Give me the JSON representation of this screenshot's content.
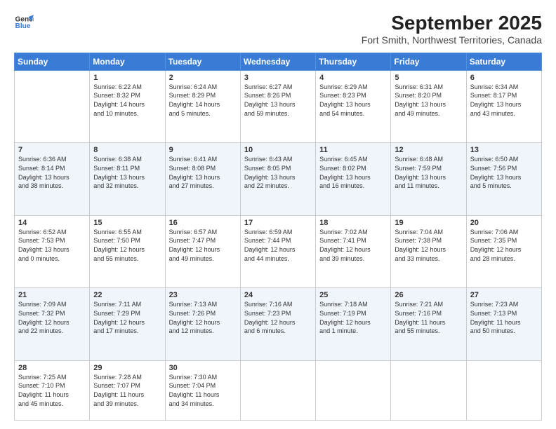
{
  "header": {
    "logo_line1": "General",
    "logo_line2": "Blue",
    "title": "September 2025",
    "subtitle": "Fort Smith, Northwest Territories, Canada"
  },
  "weekdays": [
    "Sunday",
    "Monday",
    "Tuesday",
    "Wednesday",
    "Thursday",
    "Friday",
    "Saturday"
  ],
  "weeks": [
    [
      {
        "num": "",
        "info": ""
      },
      {
        "num": "1",
        "info": "Sunrise: 6:22 AM\nSunset: 8:32 PM\nDaylight: 14 hours\nand 10 minutes."
      },
      {
        "num": "2",
        "info": "Sunrise: 6:24 AM\nSunset: 8:29 PM\nDaylight: 14 hours\nand 5 minutes."
      },
      {
        "num": "3",
        "info": "Sunrise: 6:27 AM\nSunset: 8:26 PM\nDaylight: 13 hours\nand 59 minutes."
      },
      {
        "num": "4",
        "info": "Sunrise: 6:29 AM\nSunset: 8:23 PM\nDaylight: 13 hours\nand 54 minutes."
      },
      {
        "num": "5",
        "info": "Sunrise: 6:31 AM\nSunset: 8:20 PM\nDaylight: 13 hours\nand 49 minutes."
      },
      {
        "num": "6",
        "info": "Sunrise: 6:34 AM\nSunset: 8:17 PM\nDaylight: 13 hours\nand 43 minutes."
      }
    ],
    [
      {
        "num": "7",
        "info": "Sunrise: 6:36 AM\nSunset: 8:14 PM\nDaylight: 13 hours\nand 38 minutes."
      },
      {
        "num": "8",
        "info": "Sunrise: 6:38 AM\nSunset: 8:11 PM\nDaylight: 13 hours\nand 32 minutes."
      },
      {
        "num": "9",
        "info": "Sunrise: 6:41 AM\nSunset: 8:08 PM\nDaylight: 13 hours\nand 27 minutes."
      },
      {
        "num": "10",
        "info": "Sunrise: 6:43 AM\nSunset: 8:05 PM\nDaylight: 13 hours\nand 22 minutes."
      },
      {
        "num": "11",
        "info": "Sunrise: 6:45 AM\nSunset: 8:02 PM\nDaylight: 13 hours\nand 16 minutes."
      },
      {
        "num": "12",
        "info": "Sunrise: 6:48 AM\nSunset: 7:59 PM\nDaylight: 13 hours\nand 11 minutes."
      },
      {
        "num": "13",
        "info": "Sunrise: 6:50 AM\nSunset: 7:56 PM\nDaylight: 13 hours\nand 5 minutes."
      }
    ],
    [
      {
        "num": "14",
        "info": "Sunrise: 6:52 AM\nSunset: 7:53 PM\nDaylight: 13 hours\nand 0 minutes."
      },
      {
        "num": "15",
        "info": "Sunrise: 6:55 AM\nSunset: 7:50 PM\nDaylight: 12 hours\nand 55 minutes."
      },
      {
        "num": "16",
        "info": "Sunrise: 6:57 AM\nSunset: 7:47 PM\nDaylight: 12 hours\nand 49 minutes."
      },
      {
        "num": "17",
        "info": "Sunrise: 6:59 AM\nSunset: 7:44 PM\nDaylight: 12 hours\nand 44 minutes."
      },
      {
        "num": "18",
        "info": "Sunrise: 7:02 AM\nSunset: 7:41 PM\nDaylight: 12 hours\nand 39 minutes."
      },
      {
        "num": "19",
        "info": "Sunrise: 7:04 AM\nSunset: 7:38 PM\nDaylight: 12 hours\nand 33 minutes."
      },
      {
        "num": "20",
        "info": "Sunrise: 7:06 AM\nSunset: 7:35 PM\nDaylight: 12 hours\nand 28 minutes."
      }
    ],
    [
      {
        "num": "21",
        "info": "Sunrise: 7:09 AM\nSunset: 7:32 PM\nDaylight: 12 hours\nand 22 minutes."
      },
      {
        "num": "22",
        "info": "Sunrise: 7:11 AM\nSunset: 7:29 PM\nDaylight: 12 hours\nand 17 minutes."
      },
      {
        "num": "23",
        "info": "Sunrise: 7:13 AM\nSunset: 7:26 PM\nDaylight: 12 hours\nand 12 minutes."
      },
      {
        "num": "24",
        "info": "Sunrise: 7:16 AM\nSunset: 7:23 PM\nDaylight: 12 hours\nand 6 minutes."
      },
      {
        "num": "25",
        "info": "Sunrise: 7:18 AM\nSunset: 7:19 PM\nDaylight: 12 hours\nand 1 minute."
      },
      {
        "num": "26",
        "info": "Sunrise: 7:21 AM\nSunset: 7:16 PM\nDaylight: 11 hours\nand 55 minutes."
      },
      {
        "num": "27",
        "info": "Sunrise: 7:23 AM\nSunset: 7:13 PM\nDaylight: 11 hours\nand 50 minutes."
      }
    ],
    [
      {
        "num": "28",
        "info": "Sunrise: 7:25 AM\nSunset: 7:10 PM\nDaylight: 11 hours\nand 45 minutes."
      },
      {
        "num": "29",
        "info": "Sunrise: 7:28 AM\nSunset: 7:07 PM\nDaylight: 11 hours\nand 39 minutes."
      },
      {
        "num": "30",
        "info": "Sunrise: 7:30 AM\nSunset: 7:04 PM\nDaylight: 11 hours\nand 34 minutes."
      },
      {
        "num": "",
        "info": ""
      },
      {
        "num": "",
        "info": ""
      },
      {
        "num": "",
        "info": ""
      },
      {
        "num": "",
        "info": ""
      }
    ]
  ]
}
